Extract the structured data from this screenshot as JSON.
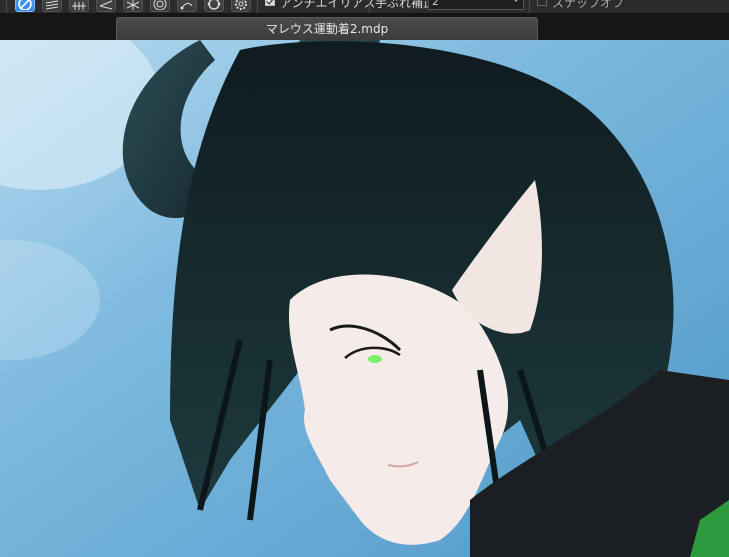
{
  "toolbar": {
    "tools": [
      "brush-tool",
      "hatch-parallel-tool",
      "grid-tool",
      "perspective-tool",
      "radial-tool",
      "concentric-tool",
      "curve-tool",
      "symmetry-tool",
      "settings-gear"
    ],
    "antialias_label": "アンチエイリアス",
    "stabilizer_label": "手ぶれ補正",
    "stabilizer_value": "2",
    "snap_label": "スナップオフ",
    "active_color": "#3d8ef0"
  },
  "tabbar": {
    "active_tab": "マレウス運動着2.mdp"
  },
  "canvas": {
    "sky_color": "#6fb0d6",
    "hair_color": "#1a2a2e",
    "eye_color": "#7cf06a",
    "skin_color": "#f5ecea"
  }
}
